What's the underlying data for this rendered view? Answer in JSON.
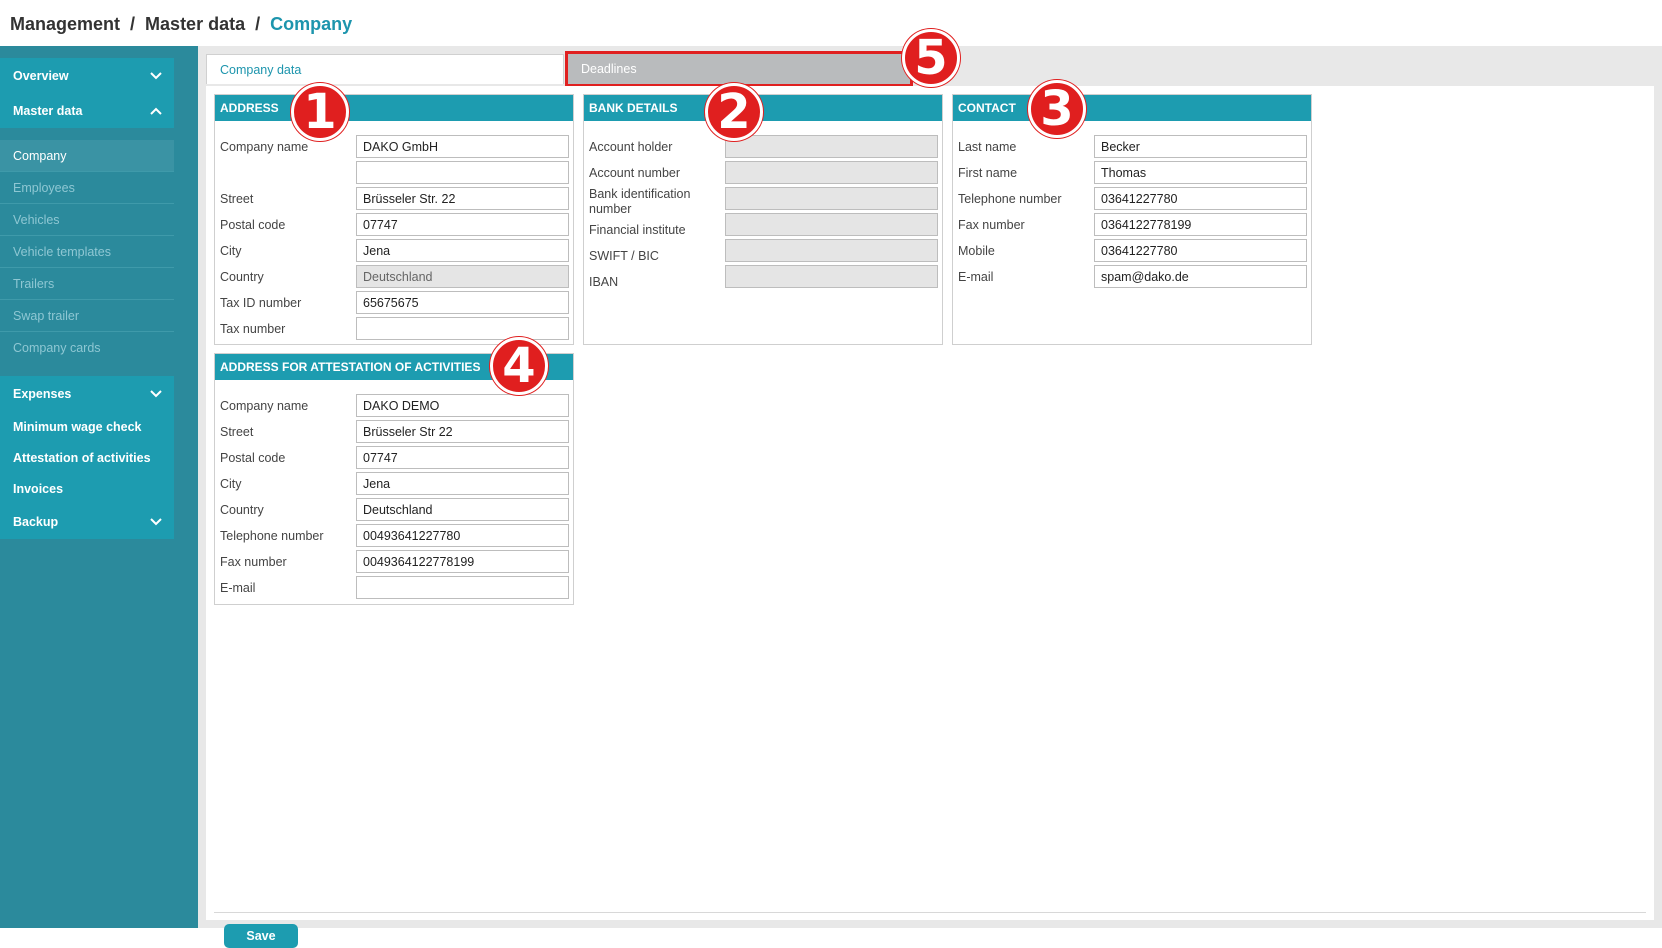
{
  "breadcrumb": {
    "level1": "Management",
    "level2": "Master data",
    "current": "Company",
    "separator": "/"
  },
  "sidebar": {
    "overview": "Overview",
    "master_data": "Master data",
    "sub_items": [
      "Company",
      "Employees",
      "Vehicles",
      "Vehicle templates",
      "Trailers",
      "Swap trailer",
      "Company cards"
    ],
    "expenses": "Expenses",
    "minimum_wage_check": "Minimum wage check",
    "attestation": "Attestation of activities",
    "invoices": "Invoices",
    "backup": "Backup"
  },
  "tabs": {
    "company_data": "Company data",
    "deadlines": "Deadlines"
  },
  "address": {
    "title": "ADDRESS",
    "company_name_label": "Company name",
    "company_name": "DAKO GmbH",
    "company_name_2": "",
    "street_label": "Street",
    "street": "Brüsseler Str. 22",
    "postal_code_label": "Postal code",
    "postal_code": "07747",
    "city_label": "City",
    "city": "Jena",
    "country_label": "Country",
    "country": "Deutschland",
    "tax_id_label": "Tax ID number",
    "tax_id": "65675675",
    "tax_number_label": "Tax number",
    "tax_number": ""
  },
  "bank": {
    "title": "BANK DETAILS",
    "account_holder_label": "Account holder",
    "account_number_label": "Account number",
    "bic_label": "Bank identification number",
    "institute_label": "Financial institute",
    "swift_label": "SWIFT / BIC",
    "iban_label": "IBAN"
  },
  "contact": {
    "title": "CONTACT",
    "last_name_label": "Last name",
    "last_name": "Becker",
    "first_name_label": "First name",
    "first_name": "Thomas",
    "telephone_label": "Telephone number",
    "telephone": "03641227780",
    "fax_label": "Fax number",
    "fax": "0364122778199",
    "mobile_label": "Mobile",
    "mobile": "03641227780",
    "email_label": "E-mail",
    "email": "spam@dako.de"
  },
  "attestation_address": {
    "title": "ADDRESS FOR ATTESTATION OF ACTIVITIES",
    "company_name_label": "Company name",
    "company_name": "DAKO DEMO",
    "street_label": "Street",
    "street": "Brüsseler Str 22",
    "postal_code_label": "Postal code",
    "postal_code": "07747",
    "city_label": "City",
    "city": "Jena",
    "country_label": "Country",
    "country": "Deutschland",
    "telephone_label": "Telephone number",
    "telephone": "00493641227780",
    "fax_label": "Fax number",
    "fax": "0049364122778199",
    "email_label": "E-mail",
    "email": ""
  },
  "annotations": [
    "1",
    "2",
    "3",
    "4",
    "5"
  ],
  "save_label": "Save",
  "colors": {
    "accent": "#1d9cb0",
    "sidebar": "#2b8a9c",
    "highlight": "#e01f1f"
  },
  "icons": {
    "expand": "chevron-down-icon",
    "collapse": "chevron-up-icon"
  }
}
